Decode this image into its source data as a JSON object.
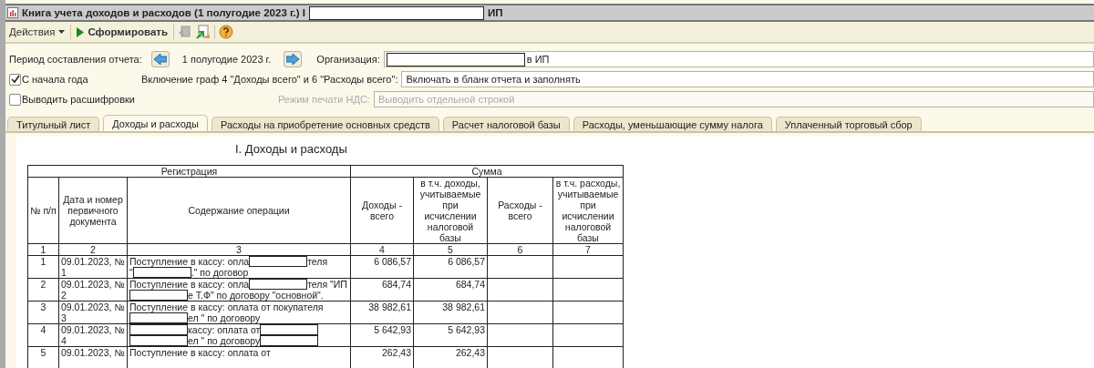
{
  "window": {
    "title": "Книга учета доходов и расходов (1 полугодие 2023 г.) I",
    "title_suffix": "ИП"
  },
  "toolbar": {
    "actions_menu": "Действия",
    "run_button": "Сформировать"
  },
  "form": {
    "period_label": "Период составления отчета:",
    "period_value": "1 полугодие 2023 г.",
    "organization_label": "Организация:",
    "organization_value": "в ИП",
    "from_year_start": {
      "label": "С начала года",
      "checked": true
    },
    "columns_label": "Включение граф 4 \"Доходы всего\" и 6 \"Расходы всего\":",
    "columns_value": "Включать в бланк отчета и заполнять",
    "show_details": {
      "label": "Выводить расшифровки",
      "checked": false
    },
    "vat_label": "Режим печати НДС:",
    "vat_value": "Выводить отдельной строкой",
    "vat_disabled": true
  },
  "tabs": [
    {
      "label": "Титульный лист",
      "selected": false
    },
    {
      "label": "Доходы и расходы",
      "selected": true
    },
    {
      "label": "Расходы на приобретение основных средств",
      "selected": false
    },
    {
      "label": "Расчет налоговой базы",
      "selected": false
    },
    {
      "label": "Расходы, уменьшающие сумму налога",
      "selected": false
    },
    {
      "label": "Уплаченный торговый сбор",
      "selected": false
    }
  ],
  "report": {
    "heading": "I. Доходы и расходы",
    "group_headers": [
      "Регистрация",
      "Сумма"
    ],
    "columns": [
      "№ п/п",
      "Дата и номер первичного документа",
      "Содержание операции",
      "Доходы - всего",
      "в т.ч. доходы, учитываемые при исчислении налоговой базы",
      "Расходы - всего",
      "в т.ч. расходы, учитываемые при исчислении налоговой базы"
    ],
    "column_numbers": [
      "1",
      "2",
      "3",
      "4",
      "5",
      "6",
      "7"
    ],
    "rows": [
      {
        "number": "1",
        "document": "09.01.2023, № 1",
        "content": [
          [
            {
              "kind": "text",
              "text": "Поступление в кассу: опла"
            },
            {
              "kind": "redacted"
            },
            {
              "kind": "text",
              "text": "теля"
            }
          ],
          [
            {
              "kind": "text",
              "text": "\""
            },
            {
              "kind": "redacted"
            },
            {
              "kind": "text",
              "text": ".\" по договор"
            }
          ]
        ],
        "income": "6 086,57",
        "income_tax": "6 086,57"
      },
      {
        "number": "2",
        "document": "09.01.2023, № 2",
        "content": [
          [
            {
              "kind": "text",
              "text": "Поступление в кассу: опла"
            },
            {
              "kind": "redacted"
            },
            {
              "kind": "text",
              "text": "теля \"ИП"
            }
          ],
          [
            {
              "kind": "redacted"
            },
            {
              "kind": "text",
              "text": "е Т.Ф\" по договору \"основной\"."
            }
          ]
        ],
        "income": "684,74",
        "income_tax": "684,74"
      },
      {
        "number": "3",
        "document": "09.01.2023, № 3",
        "content": [
          [
            {
              "kind": "text",
              "text": "Поступление в кассу: оплата от покупателя"
            }
          ],
          [
            {
              "kind": "redacted"
            },
            {
              "kind": "text",
              "text": "ел \" по договору"
            }
          ]
        ],
        "income": "38 982,61",
        "income_tax": "38 982,61"
      },
      {
        "number": "4",
        "document": "09.01.2023, № 4",
        "content": [
          [
            {
              "kind": "redacted"
            },
            {
              "kind": "text",
              "text": "кассу: оплата от"
            },
            {
              "kind": "redacted"
            }
          ],
          [
            {
              "kind": "redacted"
            },
            {
              "kind": "text",
              "text": "ел \" по договору"
            },
            {
              "kind": "redacted"
            }
          ]
        ],
        "income": "5 642,93",
        "income_tax": "5 642,93"
      },
      {
        "number": "5",
        "document": "09.01.2023, №",
        "content": [
          [
            {
              "kind": "text",
              "text": "Поступление в кассу: оплата от"
            }
          ]
        ],
        "income": "262,43",
        "income_tax": "262,43"
      }
    ]
  }
}
